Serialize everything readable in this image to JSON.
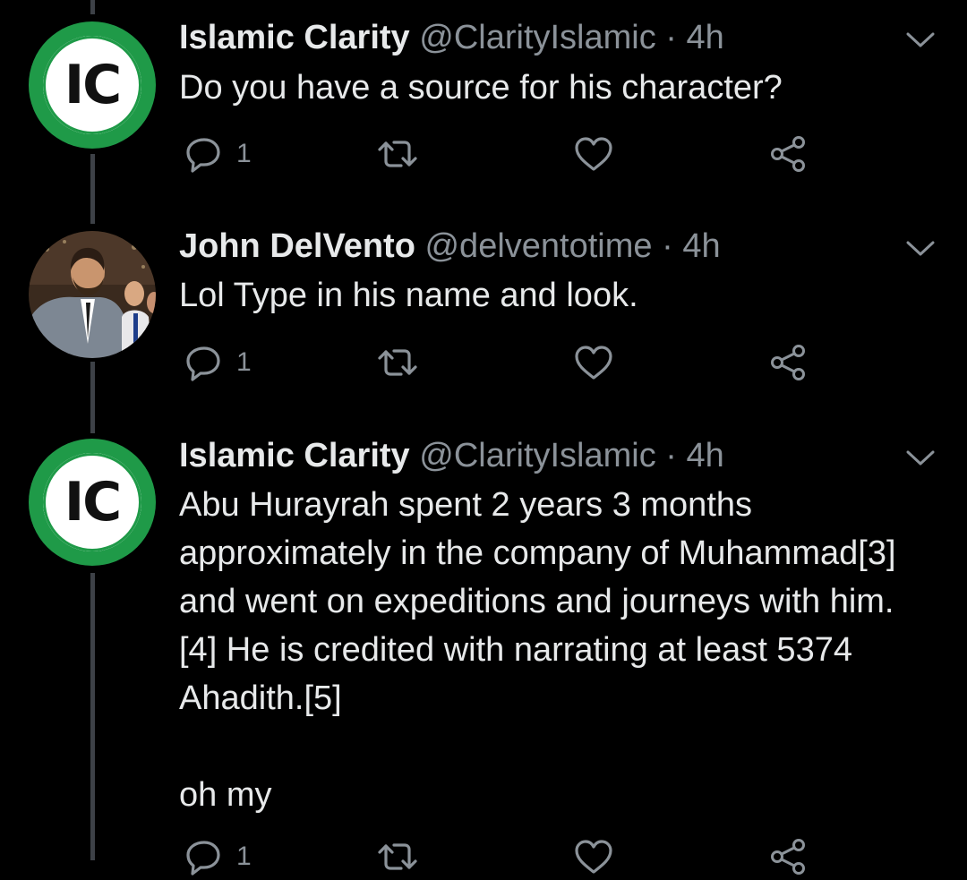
{
  "tweets": [
    {
      "name": "Islamic Clarity",
      "handle": "@ClarityIslamic",
      "separator": "·",
      "time": "4h",
      "avatar_initials": "IC",
      "text": "Do you have a source for his character?",
      "reply_count": "1",
      "avatar_icon": "ic-logo"
    },
    {
      "name": "John DelVento",
      "handle": "@delventotime",
      "separator": "·",
      "time": "4h",
      "text": "Lol Type in his name and look.",
      "reply_count": "1",
      "avatar_icon": "profile-photo"
    },
    {
      "name": "Islamic Clarity",
      "handle": "@ClarityIslamic",
      "separator": "·",
      "time": "4h",
      "avatar_initials": "IC",
      "text": "Abu Hurayrah spent 2 years 3 months approximately in the company of Muhammad[3] and went on expeditions and journeys with him.[4] He is credited with narrating at least 5374 Ahadith.[5]\n\noh my",
      "reply_count": "1",
      "avatar_icon": "ic-logo"
    }
  ],
  "colors": {
    "background": "#000000",
    "text": "#e7e9ea",
    "muted": "#8b9299",
    "thread_line": "#3d4147",
    "brand_green": "#1f9a48"
  },
  "icons": {
    "reply": "reply-icon",
    "retweet": "retweet-icon",
    "like": "heart-icon",
    "share": "share-icon",
    "menu": "chevron-down-icon"
  }
}
